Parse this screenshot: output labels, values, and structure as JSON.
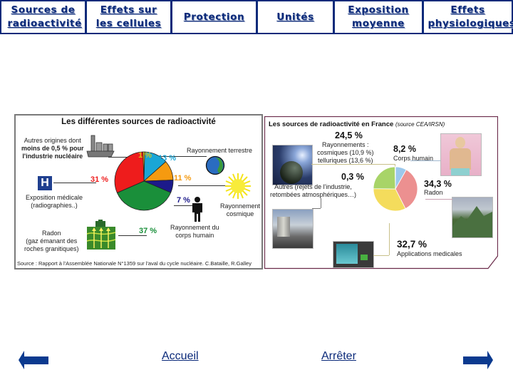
{
  "top_nav": {
    "items": [
      {
        "label": "Sources de radioactivité"
      },
      {
        "label": "Effets sur les cellules"
      },
      {
        "label": "Protection"
      },
      {
        "label": "Unités"
      },
      {
        "label": "Exposition moyenne"
      },
      {
        "label": "Effets physiologiques"
      }
    ]
  },
  "left_figure": {
    "title": "Les différentes sources de radioactivité",
    "labels": {
      "autres": [
        "Autres origines dont",
        "moins de 0,5 % pour",
        "l'industrie nucléaire"
      ],
      "terrestre": "Rayonnement terrestre",
      "medicale": [
        "Exposition médicale",
        "(radiographies..)"
      ],
      "cosmique": [
        "Rayonnement",
        "cosmique"
      ],
      "corps": [
        "Rayonnement du",
        "corps humain"
      ],
      "radon": [
        "Radon",
        "(gaz émanant des",
        "roches granitiques)"
      ]
    },
    "hospital_letter": "H",
    "source": "Source : Rapport à l'Assemblée Nationale N°1359 sur l'aval du cycle nucléaire. C.Bataille, R.Galley"
  },
  "right_figure": {
    "title": "Les sources de radioactivité en France",
    "title_source": "(source CEA/IRSN)",
    "labels": {
      "rayonnements_pct": "24,5 %",
      "rayonnements": [
        "Rayonnements :",
        "cosmiques (10,9 %)",
        "telluriques (13,6 %)"
      ],
      "corps_pct": "8,2 %",
      "corps": "Corps humain",
      "autres_pct": "0,3 %",
      "autres": [
        "Autres (rejets de l'industrie,",
        "retombées atmosphériques…)"
      ],
      "radon_pct": "34,3 %",
      "radon": "Radon",
      "medical_pct": "32,7 %",
      "medical": "Applications medicales"
    }
  },
  "bottom_nav": {
    "prev_icon": "arrow-left-icon",
    "home_label": "Accueil",
    "stop_label": "Arrêter",
    "next_icon": "arrow-right-icon"
  },
  "chart_data": [
    {
      "type": "pie",
      "title": "Les différentes sources de radioactivité",
      "categories": [
        "Autres origines",
        "Rayonnement terrestre",
        "Rayonnement cosmique",
        "Rayonnement du corps humain",
        "Radon",
        "Exposition médicale"
      ],
      "values": [
        1,
        13,
        11,
        7,
        37,
        31
      ],
      "labels": [
        "1 %",
        "13 %",
        "11 %",
        "7 %",
        "37 %",
        "31 %"
      ],
      "colors": [
        "#f2d21a",
        "#1aa6d6",
        "#f59a10",
        "#1c1a8a",
        "#1a8f3a",
        "#ee1c1c"
      ],
      "unit": "%"
    },
    {
      "type": "pie",
      "title": "Les sources de radioactivité en France (source CEA/IRSN)",
      "categories": [
        "Corps humain",
        "Radon",
        "Applications medicales",
        "Rayonnements (cosmiques + telluriques)",
        "Autres"
      ],
      "values": [
        8.2,
        34.3,
        32.7,
        24.5,
        0.3
      ],
      "labels": [
        "8,2 %",
        "34,3 %",
        "32,7 %",
        "24,5 %",
        "0,3 %"
      ],
      "colors": [
        "#9cc8ec",
        "#ec9090",
        "#f4dc5c",
        "#a8d468",
        "#888888"
      ],
      "unit": "%"
    }
  ]
}
